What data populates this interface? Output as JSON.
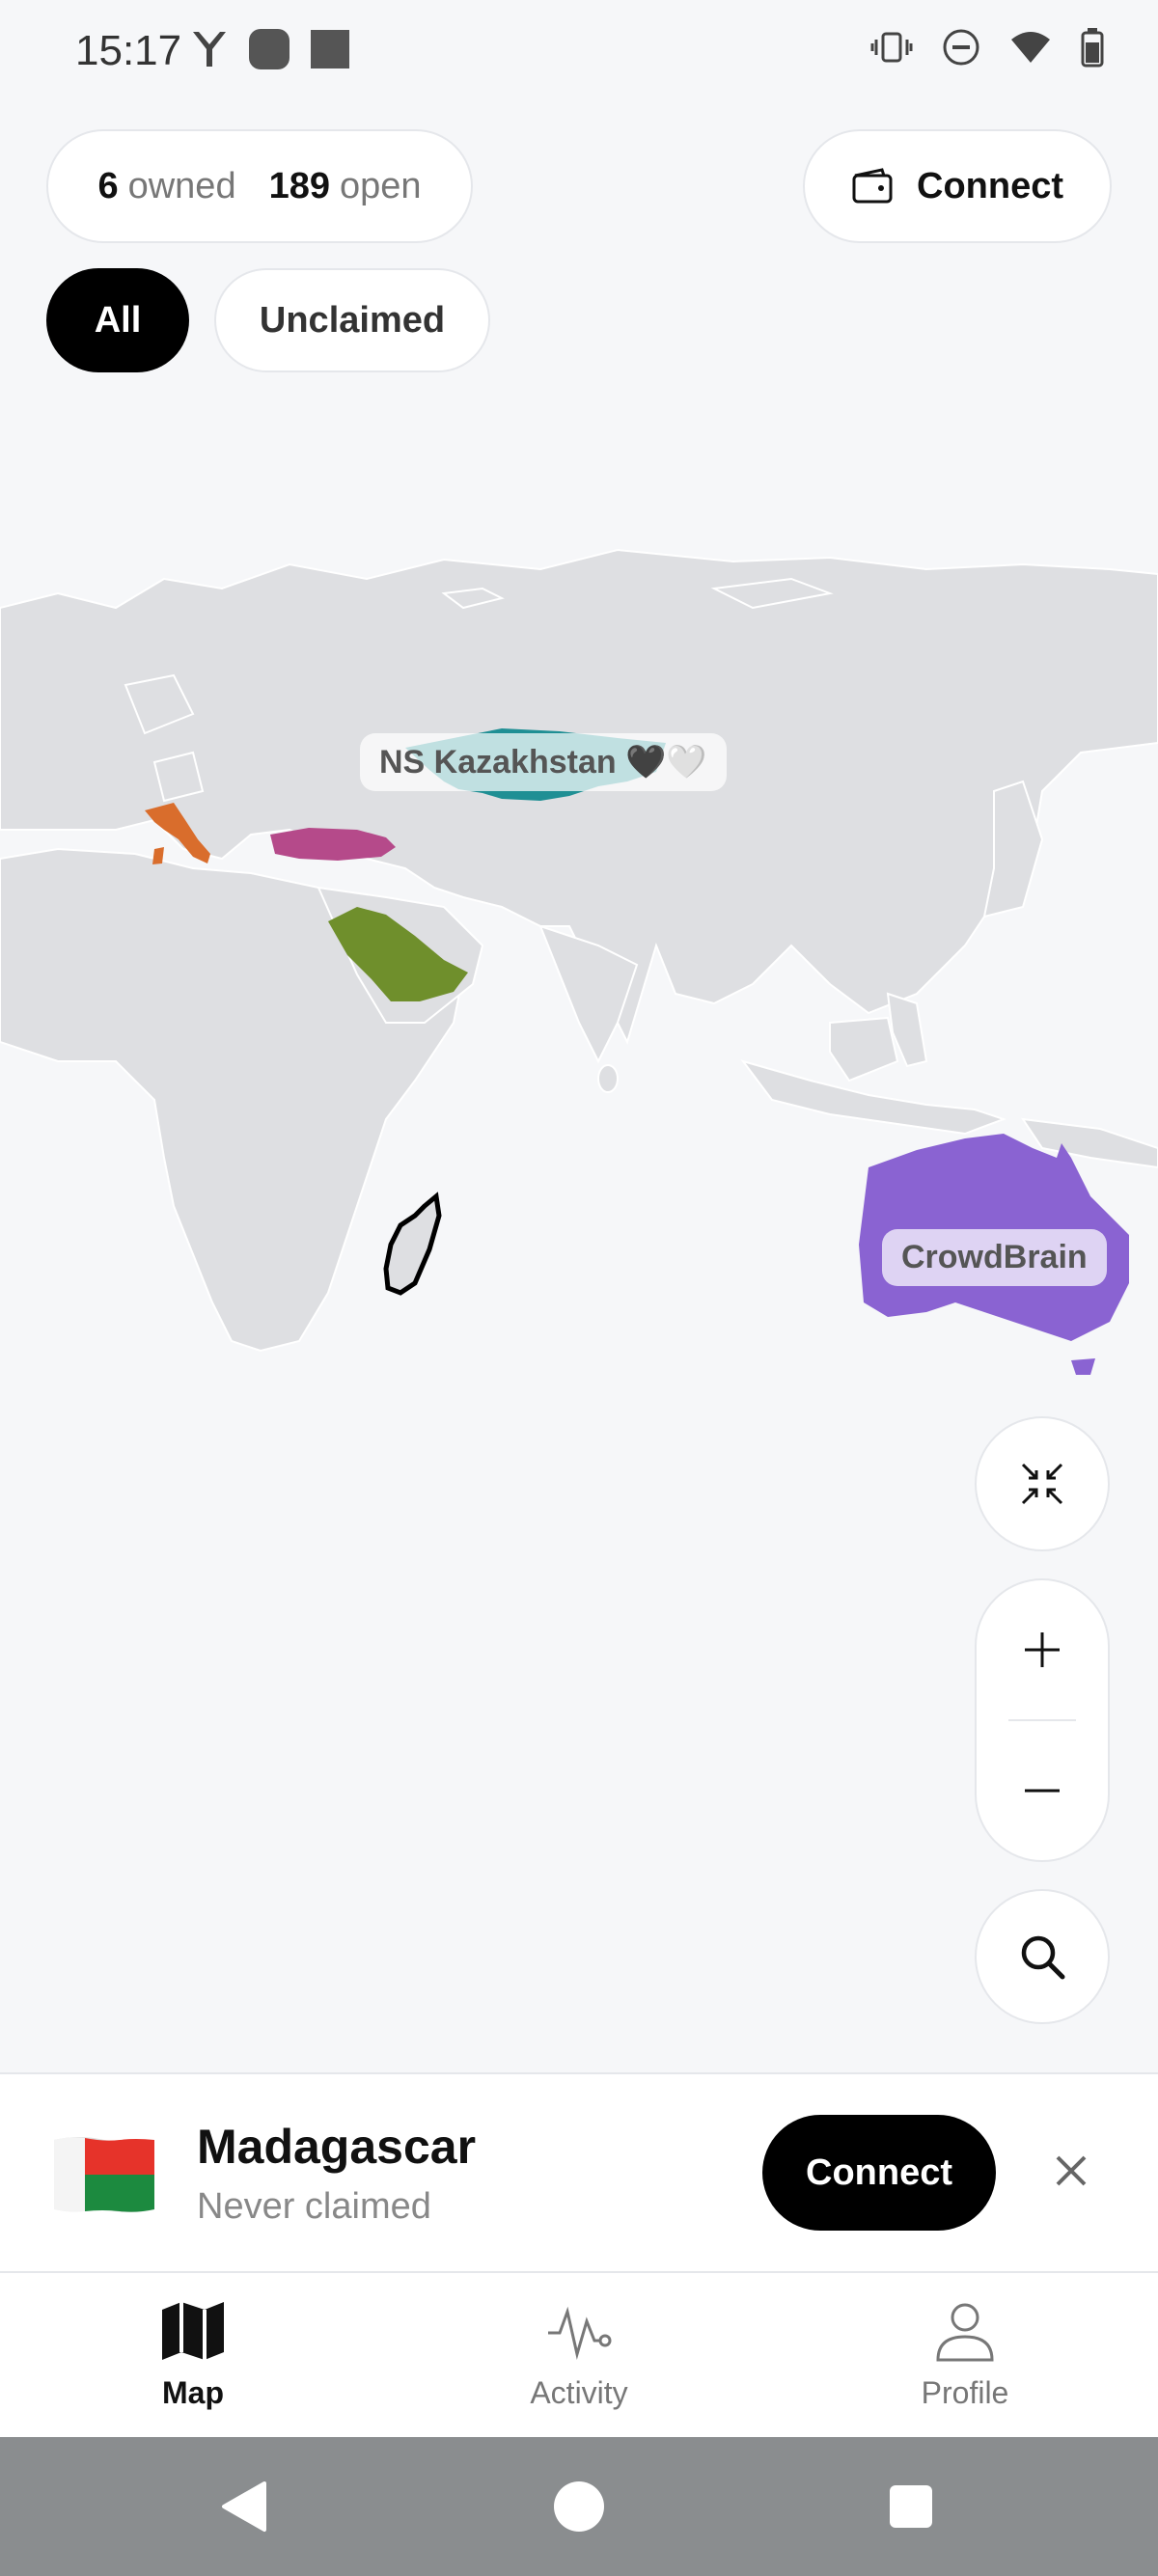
{
  "status_bar": {
    "time": "15:17"
  },
  "stats": {
    "owned_count": "6",
    "owned_label": "owned",
    "open_count": "189",
    "open_label": "open"
  },
  "top_connect": {
    "label": "Connect"
  },
  "filters": {
    "all": "All",
    "unclaimed": "Unclaimed"
  },
  "map": {
    "labels": {
      "kazakhstan": "NS Kazakhstan 🖤🤍",
      "australia": "CrowdBrain"
    },
    "colors": {
      "land": "#dedfe2",
      "italy": "#d96d2c",
      "turkey": "#b54a8a",
      "saudi_arabia": "#6f8f2c",
      "kazakhstan": "#1f8f94",
      "australia": "#8a63d2"
    }
  },
  "selected_country": {
    "name": "Madagascar",
    "status": "Never claimed",
    "connect_label": "Connect"
  },
  "nav": {
    "map": "Map",
    "activity": "Activity",
    "profile": "Profile"
  }
}
